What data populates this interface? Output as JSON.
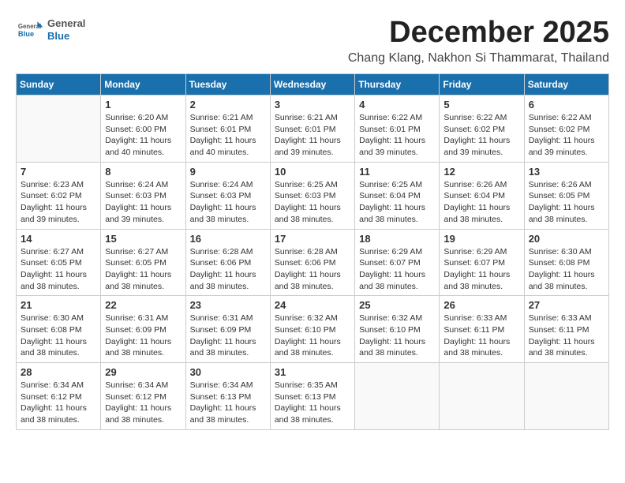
{
  "logo": {
    "general": "General",
    "blue": "Blue"
  },
  "header": {
    "month": "December 2025",
    "location": "Chang Klang, Nakhon Si Thammarat, Thailand"
  },
  "weekdays": [
    "Sunday",
    "Monday",
    "Tuesday",
    "Wednesday",
    "Thursday",
    "Friday",
    "Saturday"
  ],
  "weeks": [
    [
      {
        "day": "",
        "empty": true
      },
      {
        "day": "1",
        "sunrise": "Sunrise: 6:20 AM",
        "sunset": "Sunset: 6:00 PM",
        "daylight": "Daylight: 11 hours and 40 minutes."
      },
      {
        "day": "2",
        "sunrise": "Sunrise: 6:21 AM",
        "sunset": "Sunset: 6:01 PM",
        "daylight": "Daylight: 11 hours and 40 minutes."
      },
      {
        "day": "3",
        "sunrise": "Sunrise: 6:21 AM",
        "sunset": "Sunset: 6:01 PM",
        "daylight": "Daylight: 11 hours and 39 minutes."
      },
      {
        "day": "4",
        "sunrise": "Sunrise: 6:22 AM",
        "sunset": "Sunset: 6:01 PM",
        "daylight": "Daylight: 11 hours and 39 minutes."
      },
      {
        "day": "5",
        "sunrise": "Sunrise: 6:22 AM",
        "sunset": "Sunset: 6:02 PM",
        "daylight": "Daylight: 11 hours and 39 minutes."
      },
      {
        "day": "6",
        "sunrise": "Sunrise: 6:22 AM",
        "sunset": "Sunset: 6:02 PM",
        "daylight": "Daylight: 11 hours and 39 minutes."
      }
    ],
    [
      {
        "day": "7",
        "sunrise": "Sunrise: 6:23 AM",
        "sunset": "Sunset: 6:02 PM",
        "daylight": "Daylight: 11 hours and 39 minutes."
      },
      {
        "day": "8",
        "sunrise": "Sunrise: 6:24 AM",
        "sunset": "Sunset: 6:03 PM",
        "daylight": "Daylight: 11 hours and 39 minutes."
      },
      {
        "day": "9",
        "sunrise": "Sunrise: 6:24 AM",
        "sunset": "Sunset: 6:03 PM",
        "daylight": "Daylight: 11 hours and 38 minutes."
      },
      {
        "day": "10",
        "sunrise": "Sunrise: 6:25 AM",
        "sunset": "Sunset: 6:03 PM",
        "daylight": "Daylight: 11 hours and 38 minutes."
      },
      {
        "day": "11",
        "sunrise": "Sunrise: 6:25 AM",
        "sunset": "Sunset: 6:04 PM",
        "daylight": "Daylight: 11 hours and 38 minutes."
      },
      {
        "day": "12",
        "sunrise": "Sunrise: 6:26 AM",
        "sunset": "Sunset: 6:04 PM",
        "daylight": "Daylight: 11 hours and 38 minutes."
      },
      {
        "day": "13",
        "sunrise": "Sunrise: 6:26 AM",
        "sunset": "Sunset: 6:05 PM",
        "daylight": "Daylight: 11 hours and 38 minutes."
      }
    ],
    [
      {
        "day": "14",
        "sunrise": "Sunrise: 6:27 AM",
        "sunset": "Sunset: 6:05 PM",
        "daylight": "Daylight: 11 hours and 38 minutes."
      },
      {
        "day": "15",
        "sunrise": "Sunrise: 6:27 AM",
        "sunset": "Sunset: 6:05 PM",
        "daylight": "Daylight: 11 hours and 38 minutes."
      },
      {
        "day": "16",
        "sunrise": "Sunrise: 6:28 AM",
        "sunset": "Sunset: 6:06 PM",
        "daylight": "Daylight: 11 hours and 38 minutes."
      },
      {
        "day": "17",
        "sunrise": "Sunrise: 6:28 AM",
        "sunset": "Sunset: 6:06 PM",
        "daylight": "Daylight: 11 hours and 38 minutes."
      },
      {
        "day": "18",
        "sunrise": "Sunrise: 6:29 AM",
        "sunset": "Sunset: 6:07 PM",
        "daylight": "Daylight: 11 hours and 38 minutes."
      },
      {
        "day": "19",
        "sunrise": "Sunrise: 6:29 AM",
        "sunset": "Sunset: 6:07 PM",
        "daylight": "Daylight: 11 hours and 38 minutes."
      },
      {
        "day": "20",
        "sunrise": "Sunrise: 6:30 AM",
        "sunset": "Sunset: 6:08 PM",
        "daylight": "Daylight: 11 hours and 38 minutes."
      }
    ],
    [
      {
        "day": "21",
        "sunrise": "Sunrise: 6:30 AM",
        "sunset": "Sunset: 6:08 PM",
        "daylight": "Daylight: 11 hours and 38 minutes."
      },
      {
        "day": "22",
        "sunrise": "Sunrise: 6:31 AM",
        "sunset": "Sunset: 6:09 PM",
        "daylight": "Daylight: 11 hours and 38 minutes."
      },
      {
        "day": "23",
        "sunrise": "Sunrise: 6:31 AM",
        "sunset": "Sunset: 6:09 PM",
        "daylight": "Daylight: 11 hours and 38 minutes."
      },
      {
        "day": "24",
        "sunrise": "Sunrise: 6:32 AM",
        "sunset": "Sunset: 6:10 PM",
        "daylight": "Daylight: 11 hours and 38 minutes."
      },
      {
        "day": "25",
        "sunrise": "Sunrise: 6:32 AM",
        "sunset": "Sunset: 6:10 PM",
        "daylight": "Daylight: 11 hours and 38 minutes."
      },
      {
        "day": "26",
        "sunrise": "Sunrise: 6:33 AM",
        "sunset": "Sunset: 6:11 PM",
        "daylight": "Daylight: 11 hours and 38 minutes."
      },
      {
        "day": "27",
        "sunrise": "Sunrise: 6:33 AM",
        "sunset": "Sunset: 6:11 PM",
        "daylight": "Daylight: 11 hours and 38 minutes."
      }
    ],
    [
      {
        "day": "28",
        "sunrise": "Sunrise: 6:34 AM",
        "sunset": "Sunset: 6:12 PM",
        "daylight": "Daylight: 11 hours and 38 minutes."
      },
      {
        "day": "29",
        "sunrise": "Sunrise: 6:34 AM",
        "sunset": "Sunset: 6:12 PM",
        "daylight": "Daylight: 11 hours and 38 minutes."
      },
      {
        "day": "30",
        "sunrise": "Sunrise: 6:34 AM",
        "sunset": "Sunset: 6:13 PM",
        "daylight": "Daylight: 11 hours and 38 minutes."
      },
      {
        "day": "31",
        "sunrise": "Sunrise: 6:35 AM",
        "sunset": "Sunset: 6:13 PM",
        "daylight": "Daylight: 11 hours and 38 minutes."
      },
      {
        "day": "",
        "empty": true
      },
      {
        "day": "",
        "empty": true
      },
      {
        "day": "",
        "empty": true
      }
    ]
  ]
}
